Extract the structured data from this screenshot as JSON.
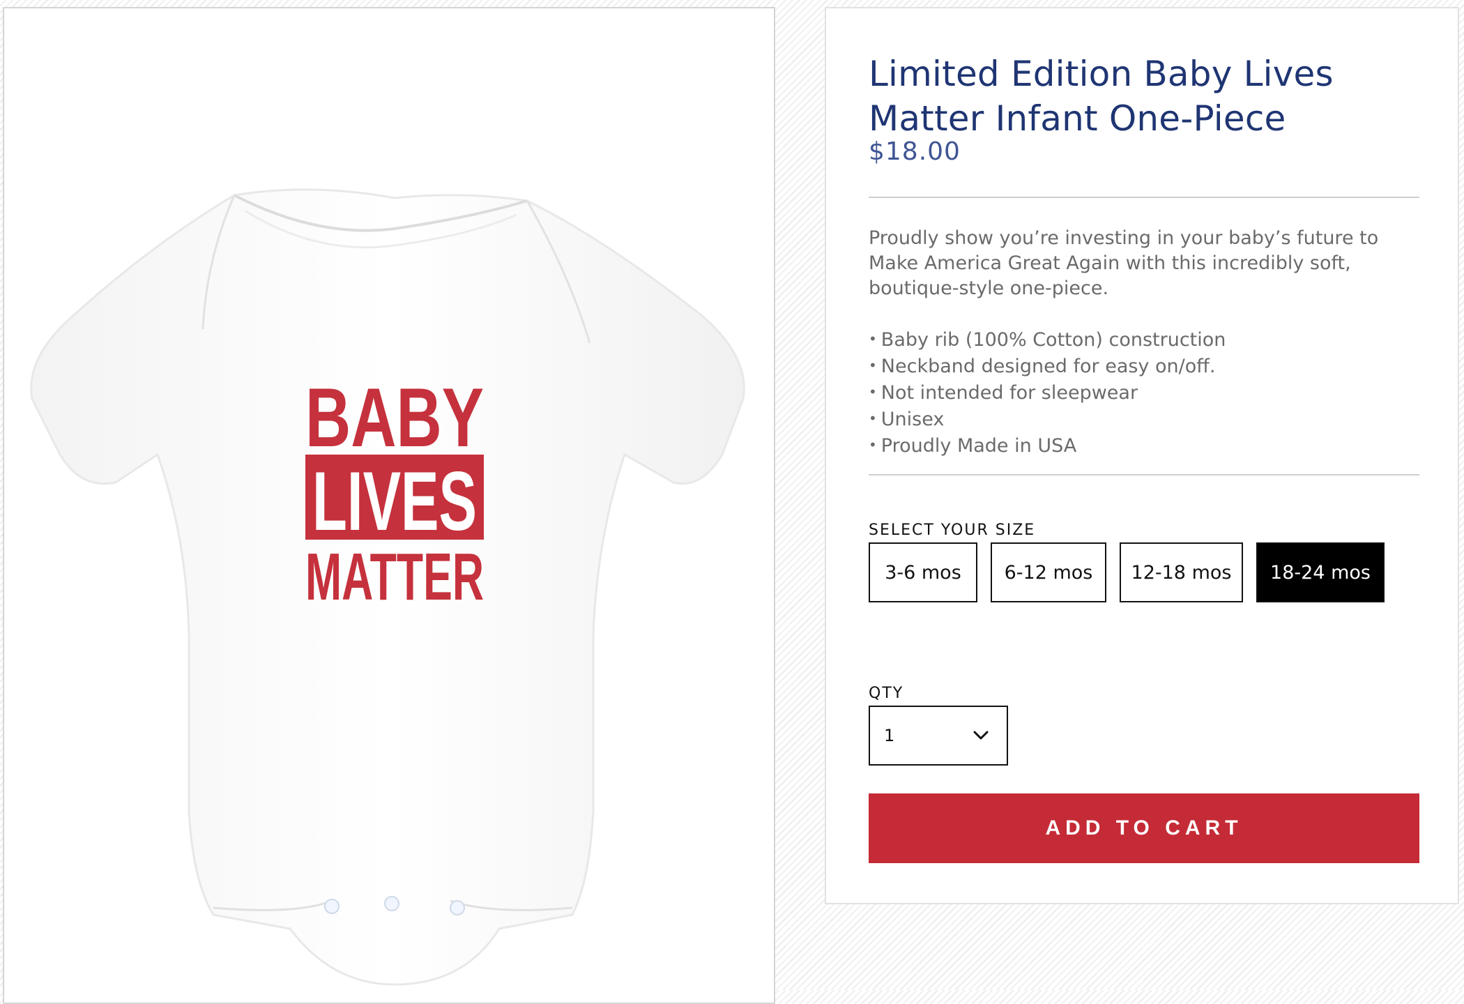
{
  "product": {
    "title": "Limited Edition Baby Lives Matter Infant One-Piece",
    "price": "$18.00",
    "description": "Proudly show you’re investing in your baby’s future to Make America Great Again with this incredibly soft, boutique-style one-piece.",
    "features": [
      "Baby rib (100% Cotton) construction",
      "Neckband designed for easy on/off.",
      "Not intended for sleepwear",
      "Unisex",
      "Proudly Made in USA"
    ],
    "image": {
      "print_lines": [
        "BABY",
        "LIVES",
        "MATTER"
      ],
      "garment_color": "#ffffff",
      "print_color": "#c5313c"
    }
  },
  "size_selector": {
    "label": "SELECT YOUR SIZE",
    "options": [
      "3-6 mos",
      "6-12 mos",
      "12-18 mos",
      "18-24 mos"
    ],
    "selected": "18-24 mos"
  },
  "quantity": {
    "label": "QTY",
    "value": "1"
  },
  "cart": {
    "button_label": "ADD TO CART"
  },
  "colors": {
    "title": "#1f3573",
    "accent_red": "#c52b36",
    "selected_size_bg": "#000000"
  },
  "icons": {
    "qty_dropdown": "chevron-down-icon"
  }
}
